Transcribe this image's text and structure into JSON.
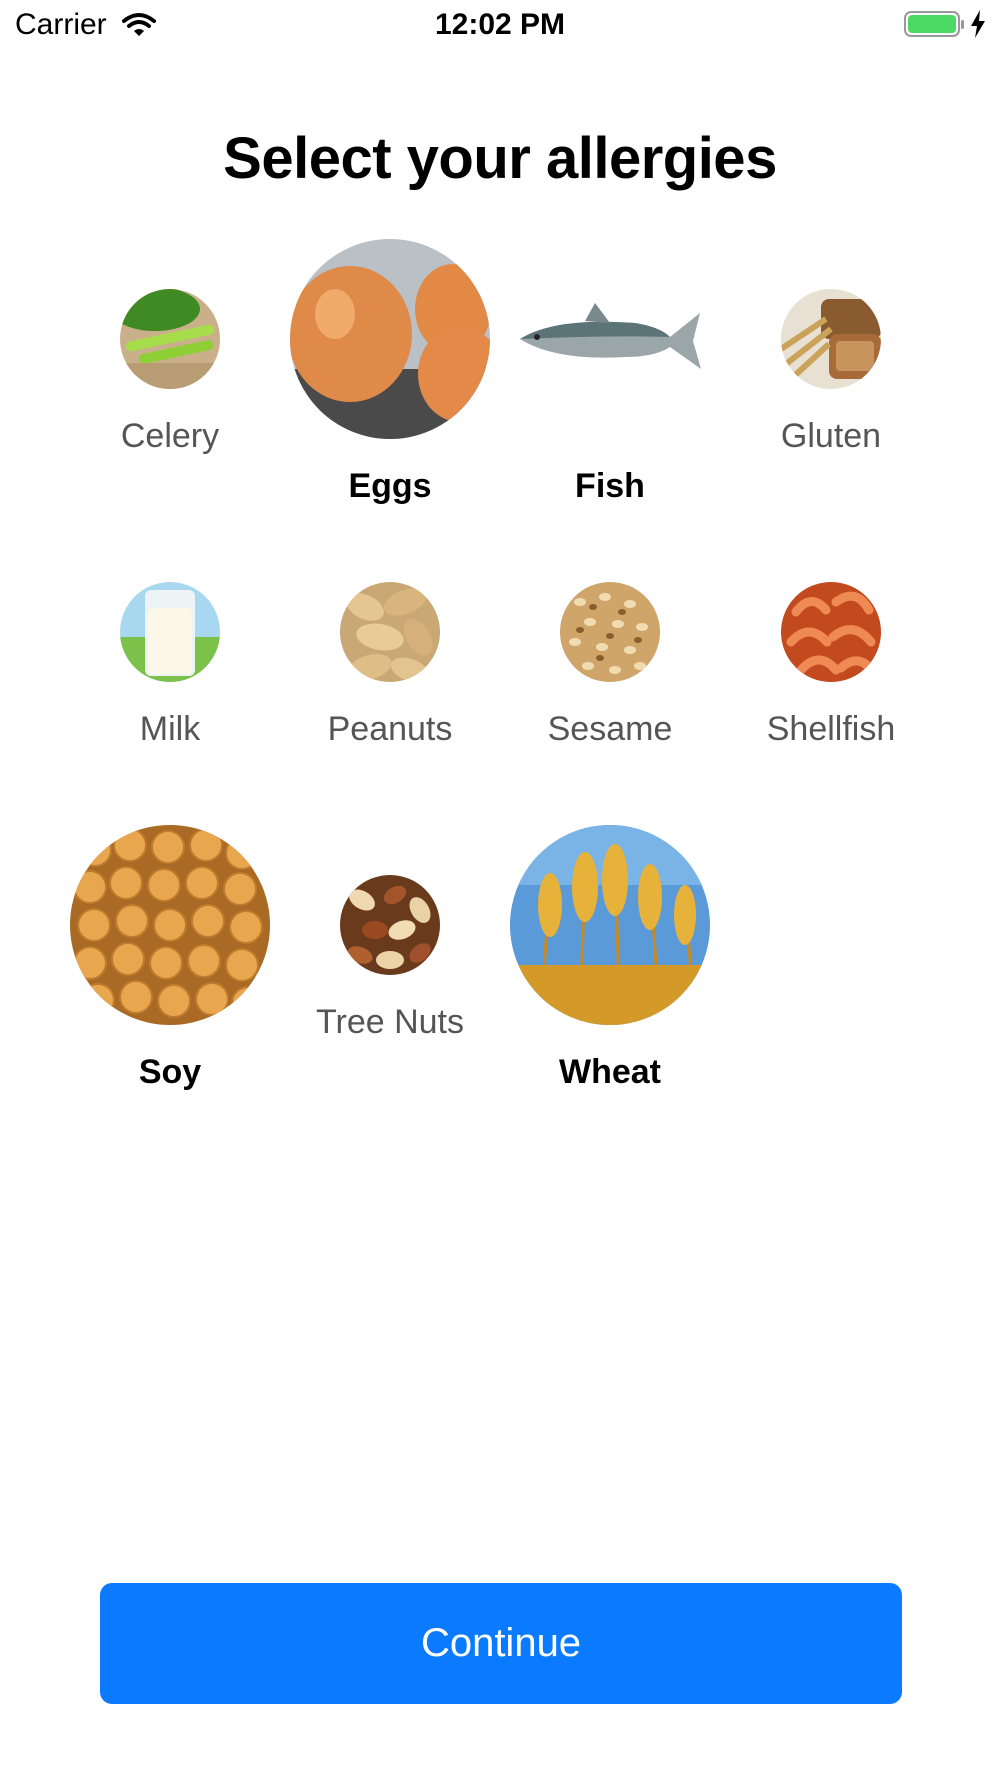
{
  "status_bar": {
    "carrier": "Carrier",
    "time": "12:02 PM"
  },
  "title": "Select your allergies",
  "allergies": [
    {
      "label": "Celery",
      "selected": false
    },
    {
      "label": "Eggs",
      "selected": true
    },
    {
      "label": "Fish",
      "selected": true
    },
    {
      "label": "Gluten",
      "selected": false
    },
    {
      "label": "Milk",
      "selected": false
    },
    {
      "label": "Peanuts",
      "selected": false
    },
    {
      "label": "Sesame",
      "selected": false
    },
    {
      "label": "Shellfish",
      "selected": false
    },
    {
      "label": "Soy",
      "selected": true
    },
    {
      "label": "Tree Nuts",
      "selected": false
    },
    {
      "label": "Wheat",
      "selected": true
    }
  ],
  "continue_label": "Continue",
  "colors": {
    "accent": "#0a7bff",
    "battery": "#4cd964",
    "unselected_text": "#555555"
  }
}
